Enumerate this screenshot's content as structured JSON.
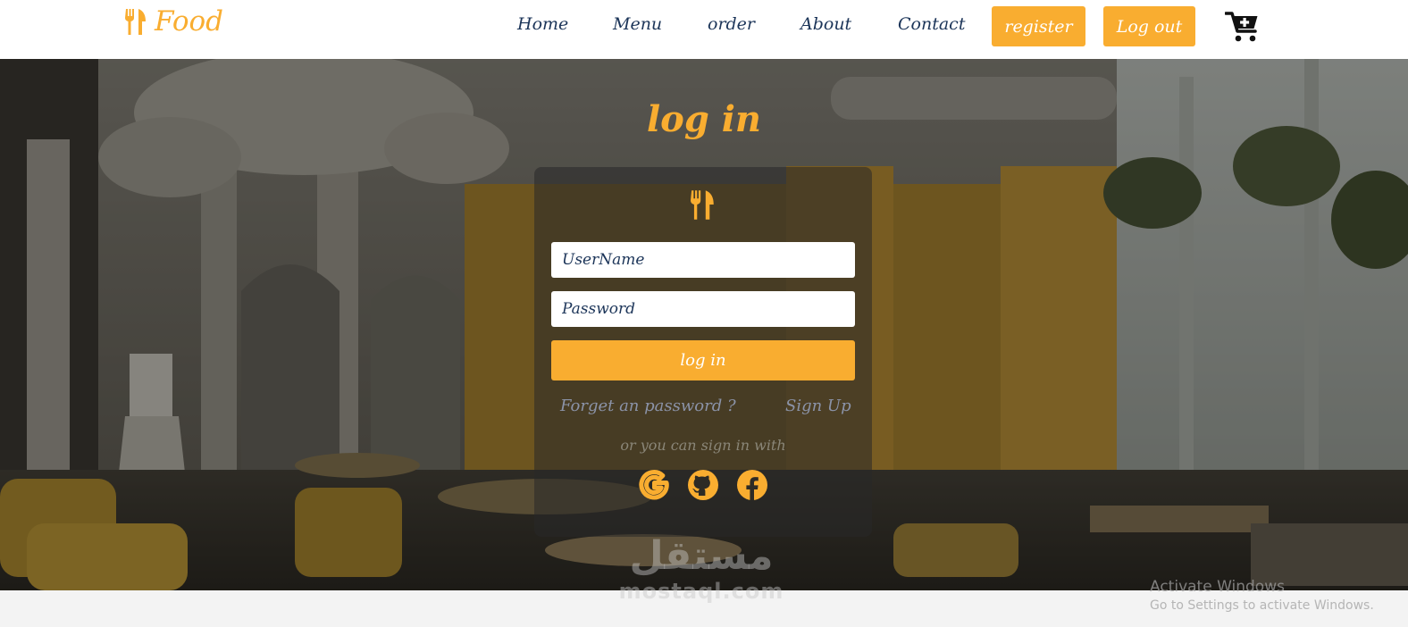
{
  "colors": {
    "accent": "#f9ad30",
    "nav_text": "#1c3559",
    "navbar_bg": "#ffffff",
    "overlay": "rgba(0,0,0,0.38)"
  },
  "brand": {
    "name": "Food",
    "icon": "fork-knife-icon"
  },
  "nav": {
    "links": [
      "Home",
      "Menu",
      "order",
      "About",
      "Contact"
    ],
    "register_label": "register",
    "logout_label": "Log out",
    "cart_icon": "cart-plus-icon"
  },
  "login": {
    "title": "log in",
    "card_icon": "fork-knife-icon",
    "username_placeholder": "UserName",
    "password_placeholder": "Password",
    "submit_label": "log in",
    "forgot_label": "Forget an password ?",
    "signup_label": "Sign Up",
    "social_prompt": "or you can sign in with",
    "social_icons": [
      "google-icon",
      "github-icon",
      "facebook-icon"
    ]
  },
  "watermark": {
    "arabic": "مستقل",
    "latin": "mostaql.com"
  },
  "os_notice": {
    "title": "Activate Windows",
    "subtitle": "Go to Settings to activate Windows."
  }
}
